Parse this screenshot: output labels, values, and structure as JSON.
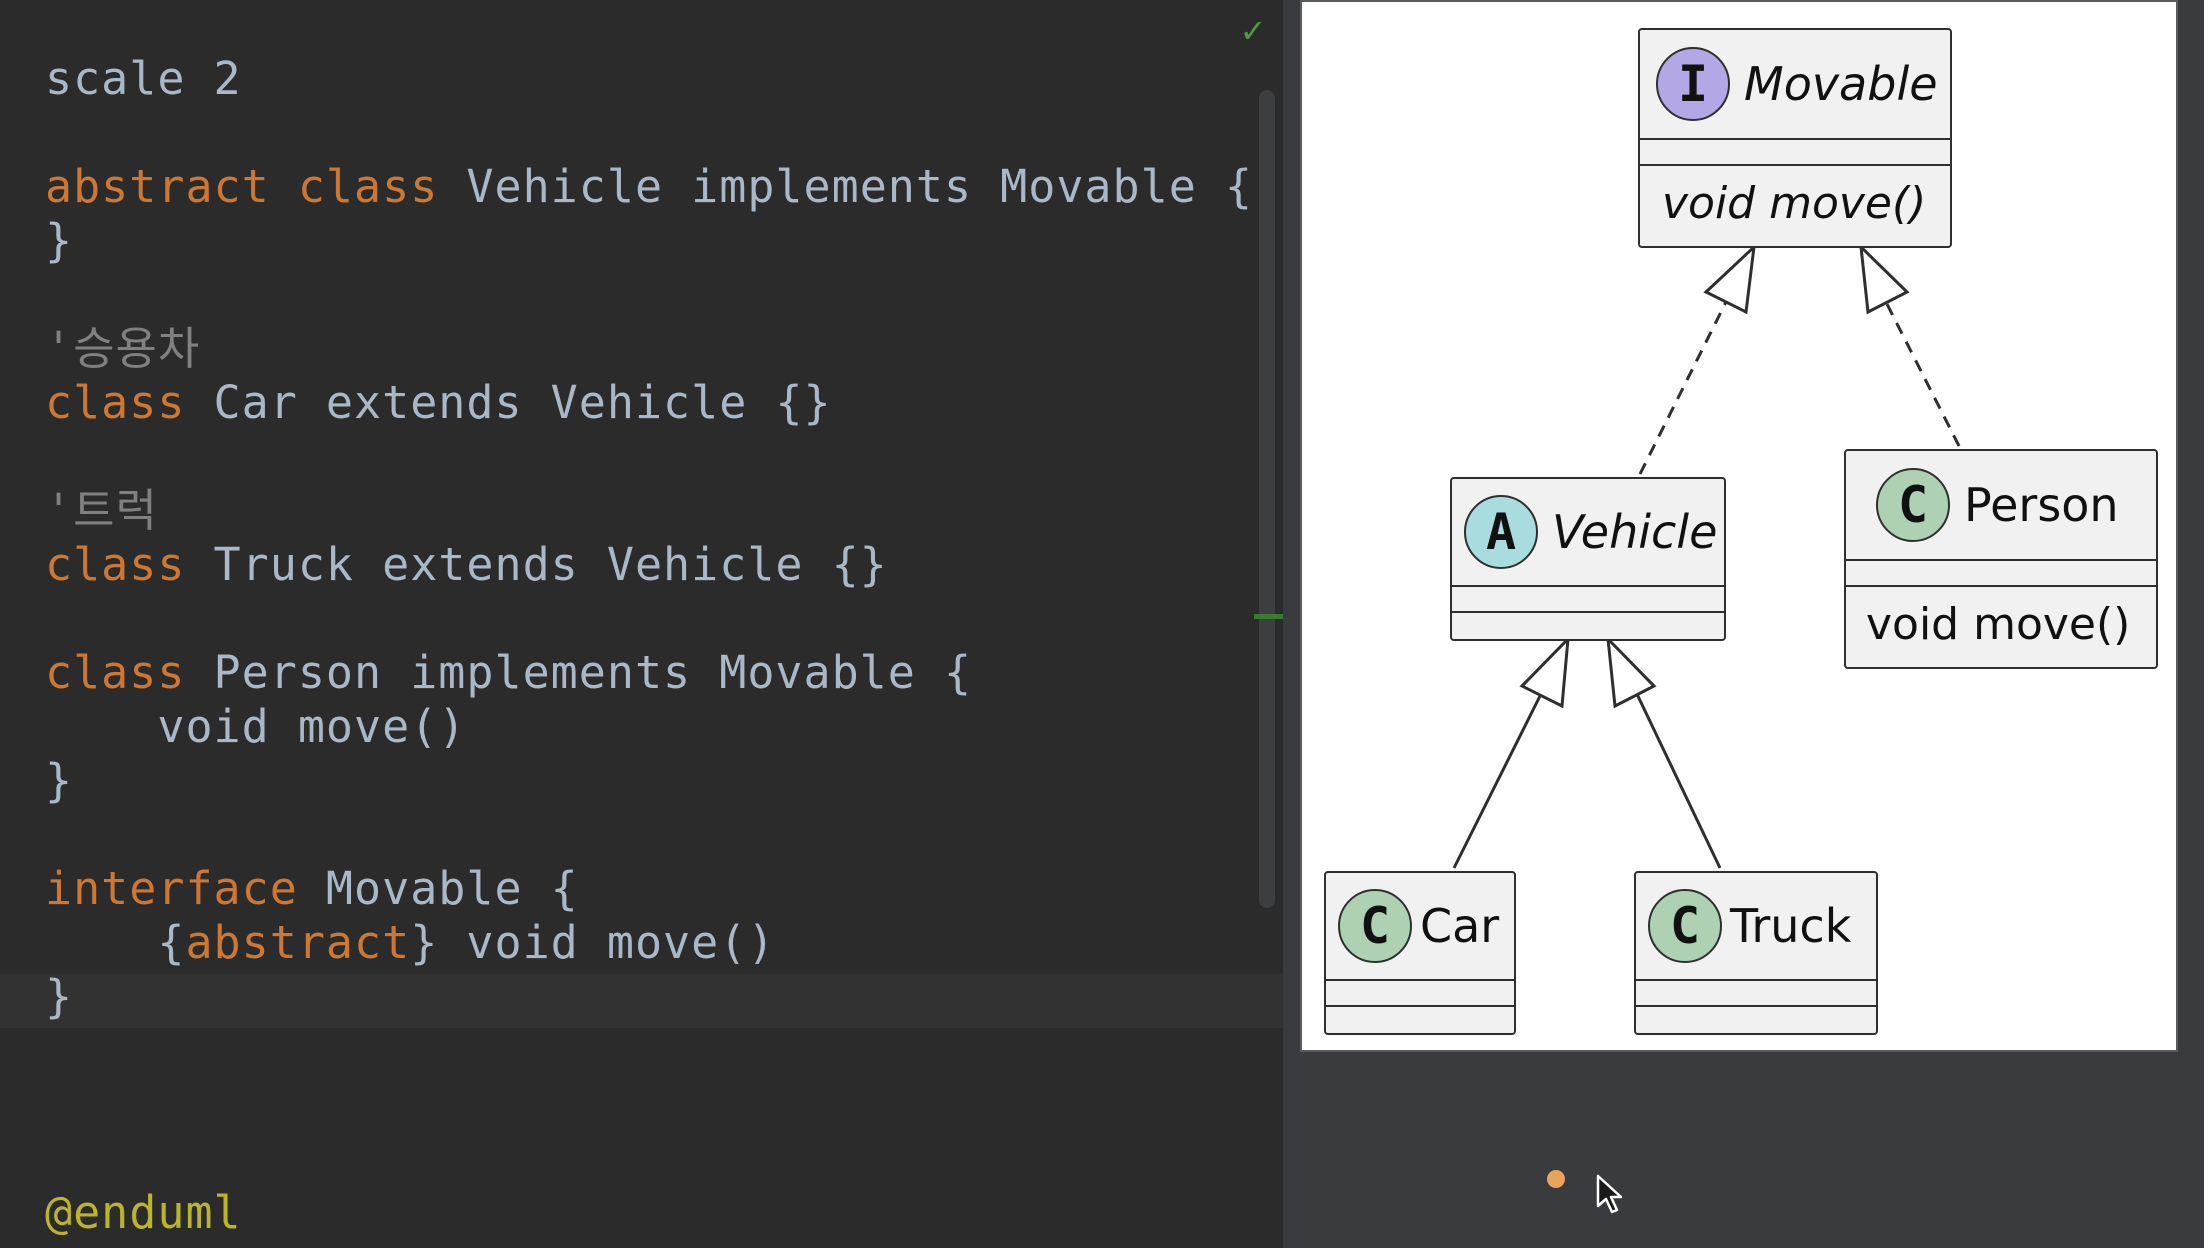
{
  "editor": {
    "lines": [
      {
        "id": "l1",
        "parts": [
          {
            "t": "scale 2",
            "c": "id"
          }
        ]
      },
      {
        "id": "l3",
        "parts": [
          {
            "t": "abstract",
            "c": "kw"
          },
          {
            "t": " ",
            "c": "id"
          },
          {
            "t": "class",
            "c": "kw"
          },
          {
            "t": " Vehicle implements Movable {",
            "c": "id"
          }
        ]
      },
      {
        "id": "l4",
        "parts": [
          {
            "t": "}",
            "c": "id"
          }
        ]
      },
      {
        "id": "l6",
        "parts": [
          {
            "t": "'승용차",
            "c": "cm"
          }
        ]
      },
      {
        "id": "l7",
        "parts": [
          {
            "t": "class",
            "c": "kw"
          },
          {
            "t": " Car extends Vehicle {}",
            "c": "id"
          }
        ]
      },
      {
        "id": "l9",
        "parts": [
          {
            "t": "'트럭",
            "c": "cm"
          }
        ]
      },
      {
        "id": "l10",
        "parts": [
          {
            "t": "class",
            "c": "kw"
          },
          {
            "t": " Truck extends Vehicle {}",
            "c": "id"
          }
        ]
      },
      {
        "id": "l12",
        "parts": [
          {
            "t": "class",
            "c": "kw"
          },
          {
            "t": " Person implements Movable {",
            "c": "id"
          }
        ]
      },
      {
        "id": "l13",
        "parts": [
          {
            "t": "    void move()",
            "c": "id"
          }
        ]
      },
      {
        "id": "l14",
        "parts": [
          {
            "t": "}",
            "c": "id"
          }
        ]
      },
      {
        "id": "l16",
        "parts": [
          {
            "t": "interface",
            "c": "kw"
          },
          {
            "t": " Movable {",
            "c": "id"
          }
        ]
      },
      {
        "id": "l17",
        "parts": [
          {
            "t": "    {",
            "c": "id"
          },
          {
            "t": "abstract",
            "c": "kw"
          },
          {
            "t": "} void move()",
            "c": "id"
          }
        ]
      },
      {
        "id": "l18",
        "parts": [
          {
            "t": "}",
            "c": "id"
          }
        ]
      },
      {
        "id": "l22",
        "parts": [
          {
            "t": "@enduml",
            "c": "ann"
          }
        ]
      }
    ]
  },
  "diagram": {
    "movable": {
      "badge": "I",
      "name": "Movable",
      "member": "void move()"
    },
    "vehicle": {
      "badge": "A",
      "name": "Vehicle"
    },
    "person": {
      "badge": "C",
      "name": "Person",
      "member": "void move()"
    },
    "car": {
      "badge": "C",
      "name": "Car"
    },
    "truck": {
      "badge": "C",
      "name": "Truck"
    }
  },
  "colors": {
    "interface_badge": "#b4a7e5",
    "abstract_badge": "#a9dcdf",
    "class_badge": "#add1b2",
    "keyword": "#cc7832",
    "comment": "#808080",
    "annotation": "#bbb529",
    "status_ok": "#4e9a3e"
  },
  "icons": {
    "status": "check-icon",
    "pointer": "mouse-pointer-icon"
  }
}
